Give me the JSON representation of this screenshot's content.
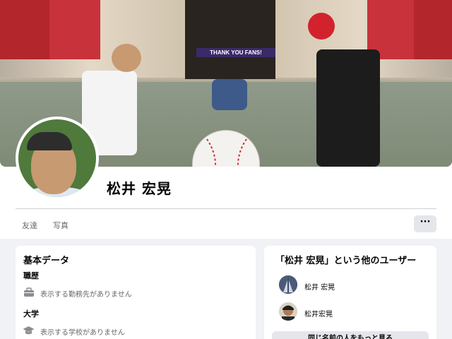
{
  "profile": {
    "name": "松井 宏晃",
    "cover_sign": "THANK YOU FANS!"
  },
  "tabs": [
    {
      "label": "友達"
    },
    {
      "label": "写真"
    }
  ],
  "more_button": {
    "label": "···"
  },
  "basic_data": {
    "title": "基本データ",
    "work": {
      "heading": "職歴",
      "icon": "briefcase-icon",
      "empty": "表示する勤務先がありません"
    },
    "education": {
      "heading": "大学",
      "icon": "graduation-cap-icon",
      "empty": "表示する学校がありません"
    }
  },
  "others": {
    "title": "「松井 宏晃」という他のユーザー",
    "users": [
      {
        "name": "松井 宏晃"
      },
      {
        "name": "松井宏晃"
      }
    ],
    "see_more": "同じ名前の人をもっと見る"
  },
  "colors": {
    "page_bg": "#f0f2f5",
    "card_bg": "#ffffff",
    "secondary_text": "#65676b",
    "button_gray": "#e4e6eb"
  }
}
